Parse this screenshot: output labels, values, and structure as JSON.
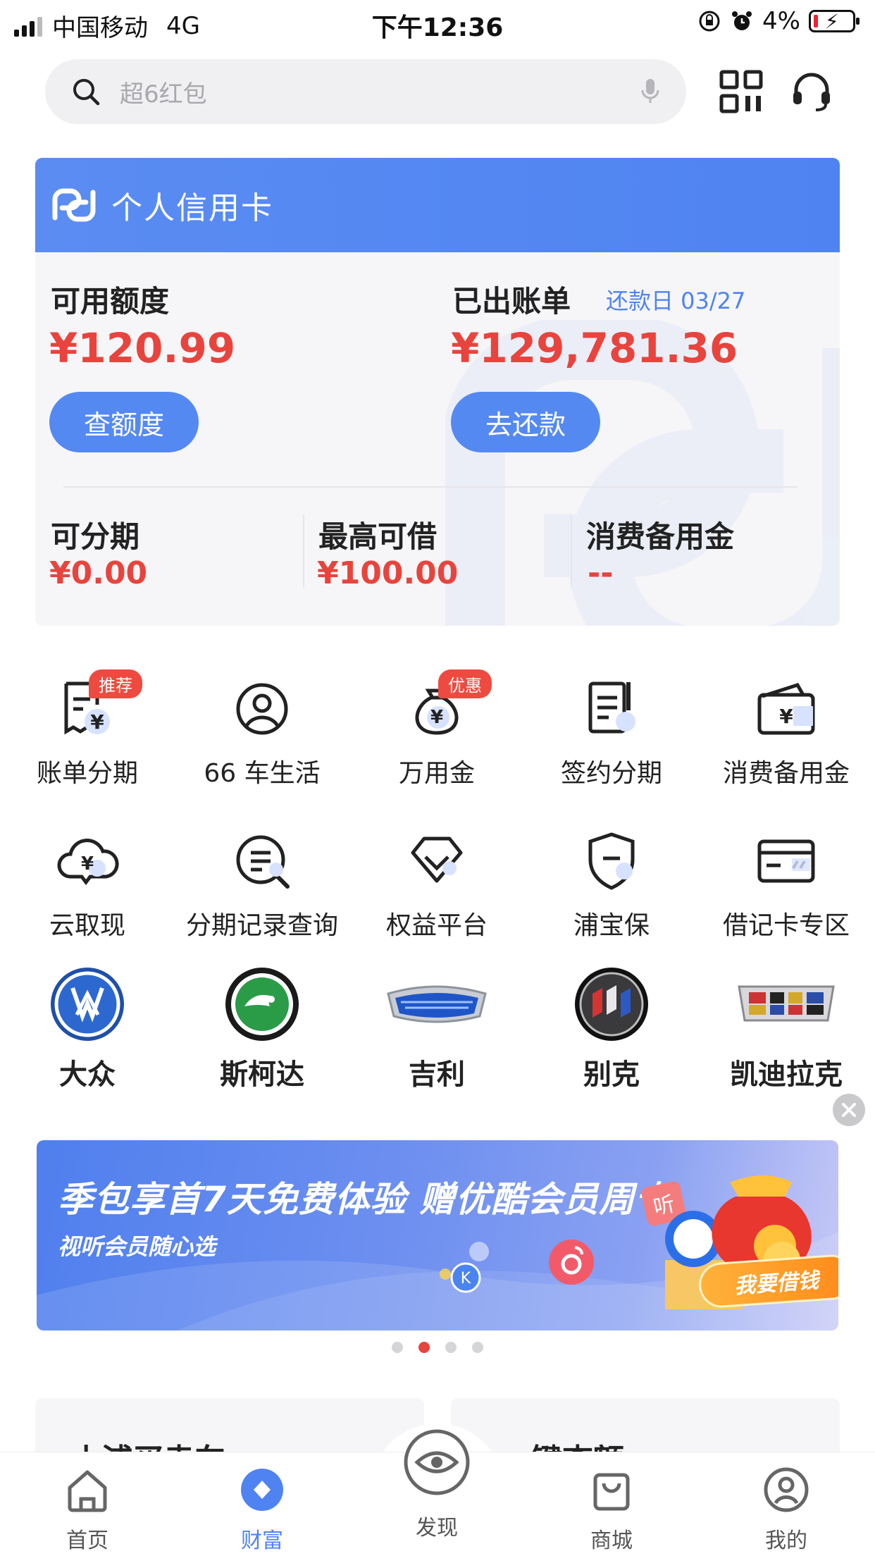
{
  "status_bar": {
    "carrier": "中国移动",
    "network": "4G",
    "time": "下午12:36",
    "battery": "4%"
  },
  "search": {
    "placeholder": "超6红包"
  },
  "credit_card": {
    "title": "个人信用卡",
    "available_label": "可用额度",
    "available_amount": "¥120.99",
    "check_limit_button": "查额度",
    "statement_label": "已出账单",
    "due_date": "还款日 03/27",
    "statement_amount": "¥129,781.36",
    "repay_button": "去还款",
    "stats": [
      {
        "label": "可分期",
        "value": "¥0.00"
      },
      {
        "label": "最高可借",
        "value": "¥100.00"
      },
      {
        "label": "消费备用金",
        "value": "--"
      }
    ]
  },
  "services": [
    {
      "label": "账单分期",
      "icon": "bill-installment-icon",
      "badge": "推荐"
    },
    {
      "label": "66 车生活",
      "icon": "car-life-icon",
      "badge": ""
    },
    {
      "label": "万用金",
      "icon": "money-bag-icon",
      "badge": "优惠"
    },
    {
      "label": "签约分期",
      "icon": "contract-installment-icon",
      "badge": ""
    },
    {
      "label": "消费备用金",
      "icon": "wallet-icon",
      "badge": ""
    },
    {
      "label": "云取现",
      "icon": "cloud-cash-icon",
      "badge": ""
    },
    {
      "label": "分期记录查询",
      "icon": "record-search-icon",
      "badge": ""
    },
    {
      "label": "权益平台",
      "icon": "diamond-icon",
      "badge": ""
    },
    {
      "label": "浦宝保",
      "icon": "shield-icon",
      "badge": ""
    },
    {
      "label": "借记卡专区",
      "icon": "debit-card-icon",
      "badge": ""
    }
  ],
  "car_brands": [
    {
      "label": "大众",
      "icon": "volkswagen-logo"
    },
    {
      "label": "斯柯达",
      "icon": "skoda-logo"
    },
    {
      "label": "吉利",
      "icon": "geely-logo"
    },
    {
      "label": "别克",
      "icon": "buick-logo"
    },
    {
      "label": "凯迪拉克",
      "icon": "cadillac-logo"
    }
  ],
  "banner": {
    "headline": "季包享首7天免费体验 赠优酷会员周卡",
    "subline": "视听会员随心选",
    "cta": "我要借钱",
    "sticker": "听",
    "carousel_total": 4,
    "carousel_active": 2
  },
  "peek_cards": [
    {
      "title": "小浦买卖车"
    },
    {
      "title": "一键查额"
    }
  ],
  "tabs": [
    {
      "label": "首页",
      "icon": "home-icon"
    },
    {
      "label": "财富",
      "icon": "wealth-icon"
    },
    {
      "label": "发现",
      "icon": "discover-eye-icon"
    },
    {
      "label": "商城",
      "icon": "shopping-bag-icon"
    },
    {
      "label": "我的",
      "icon": "profile-icon"
    }
  ],
  "active_tab": "财富",
  "colors": {
    "primary_blue": "#4F83F1",
    "amount_red": "#E8443D",
    "badge_red": "#EF4A3F"
  }
}
